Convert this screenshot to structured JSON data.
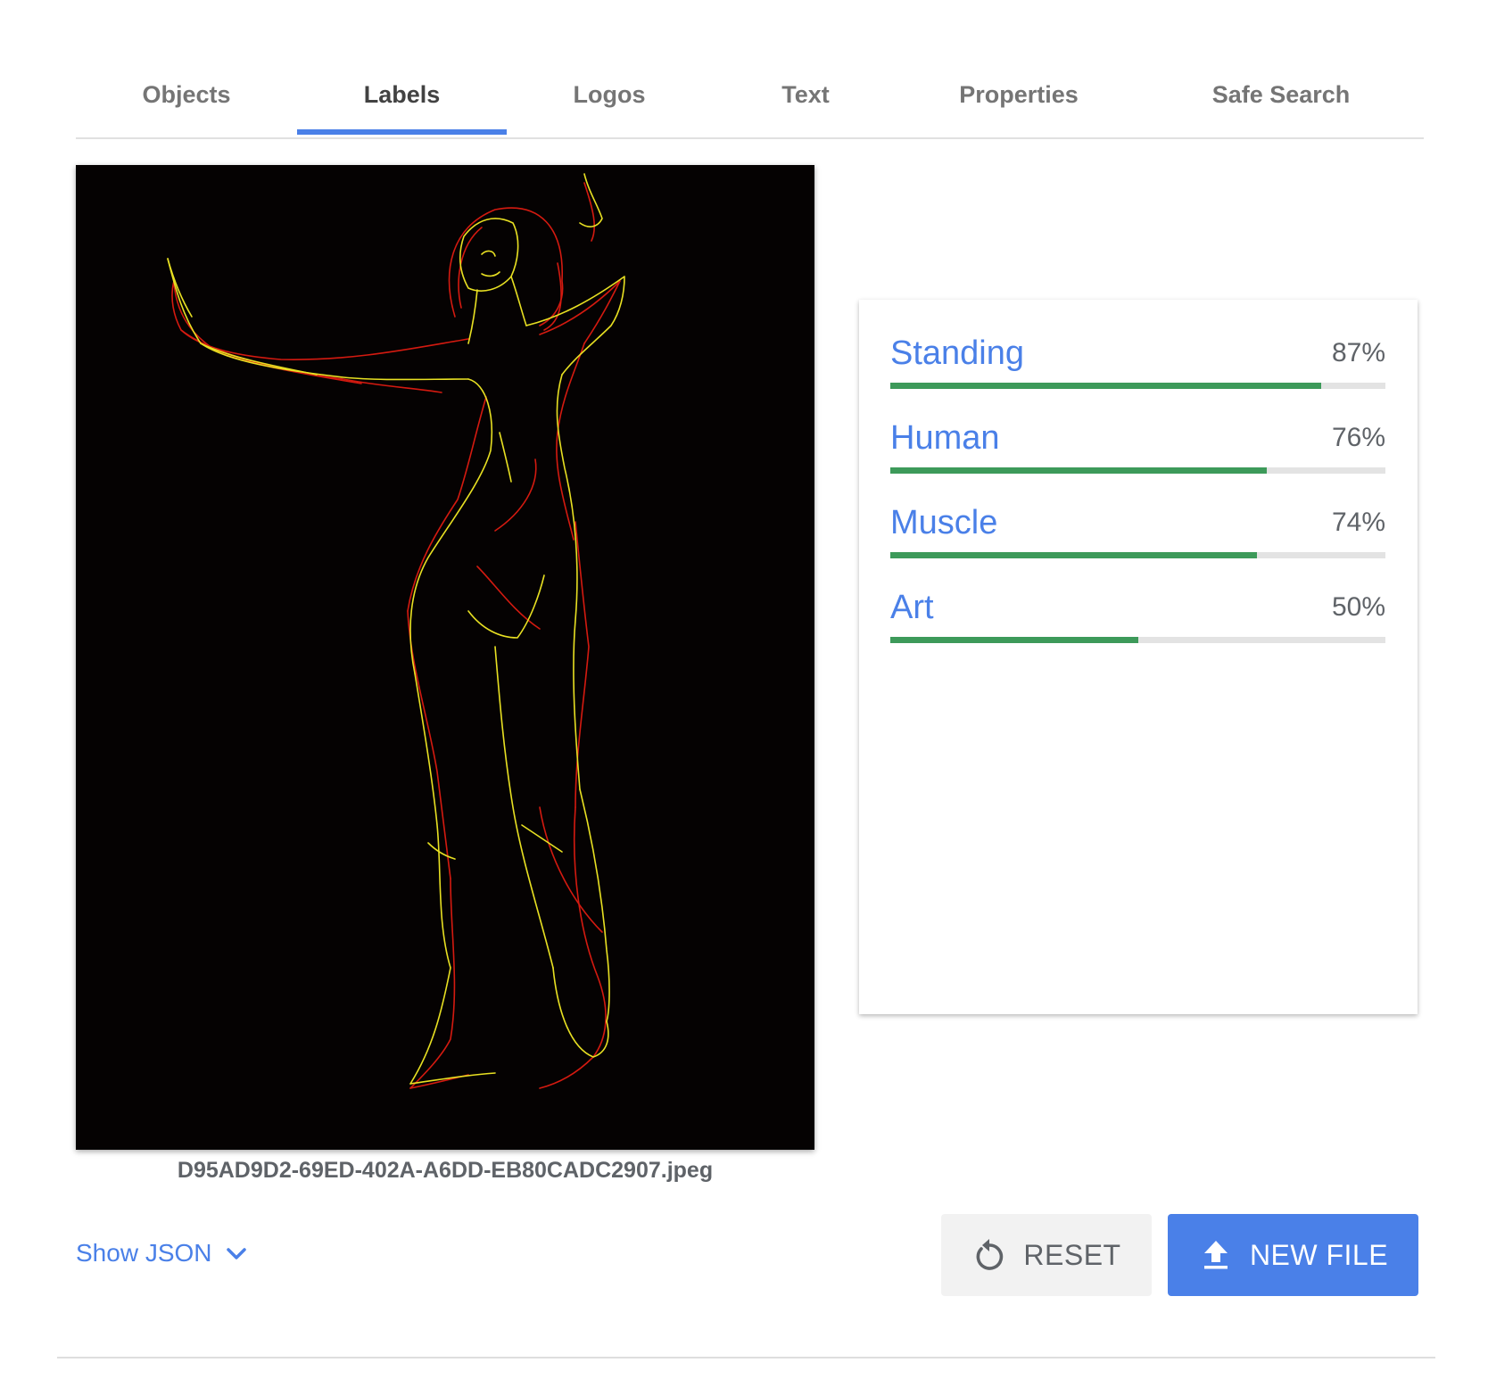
{
  "tabs": [
    {
      "label": "Objects",
      "active": false
    },
    {
      "label": "Labels",
      "active": true
    },
    {
      "label": "Logos",
      "active": false
    },
    {
      "label": "Text",
      "active": false
    },
    {
      "label": "Properties",
      "active": false
    },
    {
      "label": "Safe Search",
      "active": false
    }
  ],
  "image": {
    "filename": "D95AD9D2-69ED-402A-A6DD-EB80CADC2907.jpeg",
    "background": "#050202",
    "stroke_colors": [
      "#e8e022",
      "#d41a10"
    ]
  },
  "labels": [
    {
      "name": "Standing",
      "score_text": "87%",
      "score": 0.87
    },
    {
      "name": "Human",
      "score_text": "76%",
      "score": 0.76
    },
    {
      "name": "Muscle",
      "score_text": "74%",
      "score": 0.74
    },
    {
      "name": "Art",
      "score_text": "50%",
      "score": 0.5
    }
  ],
  "controls": {
    "show_json_label": "Show JSON",
    "reset_label": "RESET",
    "new_file_label": "NEW FILE"
  },
  "colors": {
    "accent": "#4a80e8",
    "bar_fill": "#3d9a5a",
    "bar_track": "#e3e3e3"
  }
}
